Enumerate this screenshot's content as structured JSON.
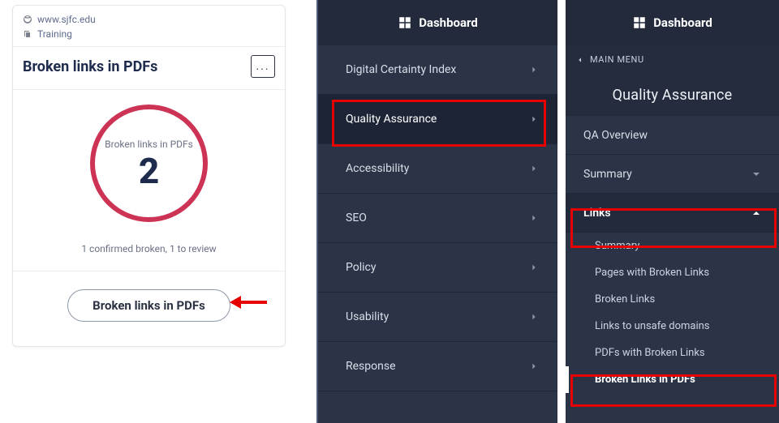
{
  "card": {
    "site_label": "www.sjfc.edu",
    "training_label": "Training",
    "title": "Broken links in PDFs",
    "more_label": "...",
    "ring_label": "Broken links in PDFs",
    "ring_value": "2",
    "caption": "1 confirmed broken, 1 to review",
    "button_label": "Broken links in PDFs"
  },
  "middle": {
    "dashboard": "Dashboard",
    "items": [
      "Digital Certainty Index",
      "Quality Assurance",
      "Accessibility",
      "SEO",
      "Policy",
      "Usability",
      "Response"
    ],
    "selected_index": 1
  },
  "right": {
    "dashboard": "Dashboard",
    "back_label": "MAIN MENU",
    "section_title": "Quality Assurance",
    "items": [
      {
        "label": "QA Overview",
        "expandable": false
      },
      {
        "label": "Summary",
        "expandable": true,
        "expanded": false
      },
      {
        "label": "Links",
        "expandable": true,
        "expanded": true,
        "children": [
          "Summary",
          "Pages with Broken Links",
          "Broken Links",
          "Links to unsafe domains",
          "PDFs with Broken Links",
          "Broken Links in PDFs"
        ],
        "current_child_index": 5
      }
    ],
    "highlight_colors": {
      "annotation_red": "#e60000",
      "arrow_red": "#e60000"
    }
  },
  "chart_data": {
    "type": "single_value",
    "title": "Broken links in PDFs",
    "value": 2,
    "caption": "1 confirmed broken, 1 to review",
    "ring_color": "#cc3355"
  }
}
